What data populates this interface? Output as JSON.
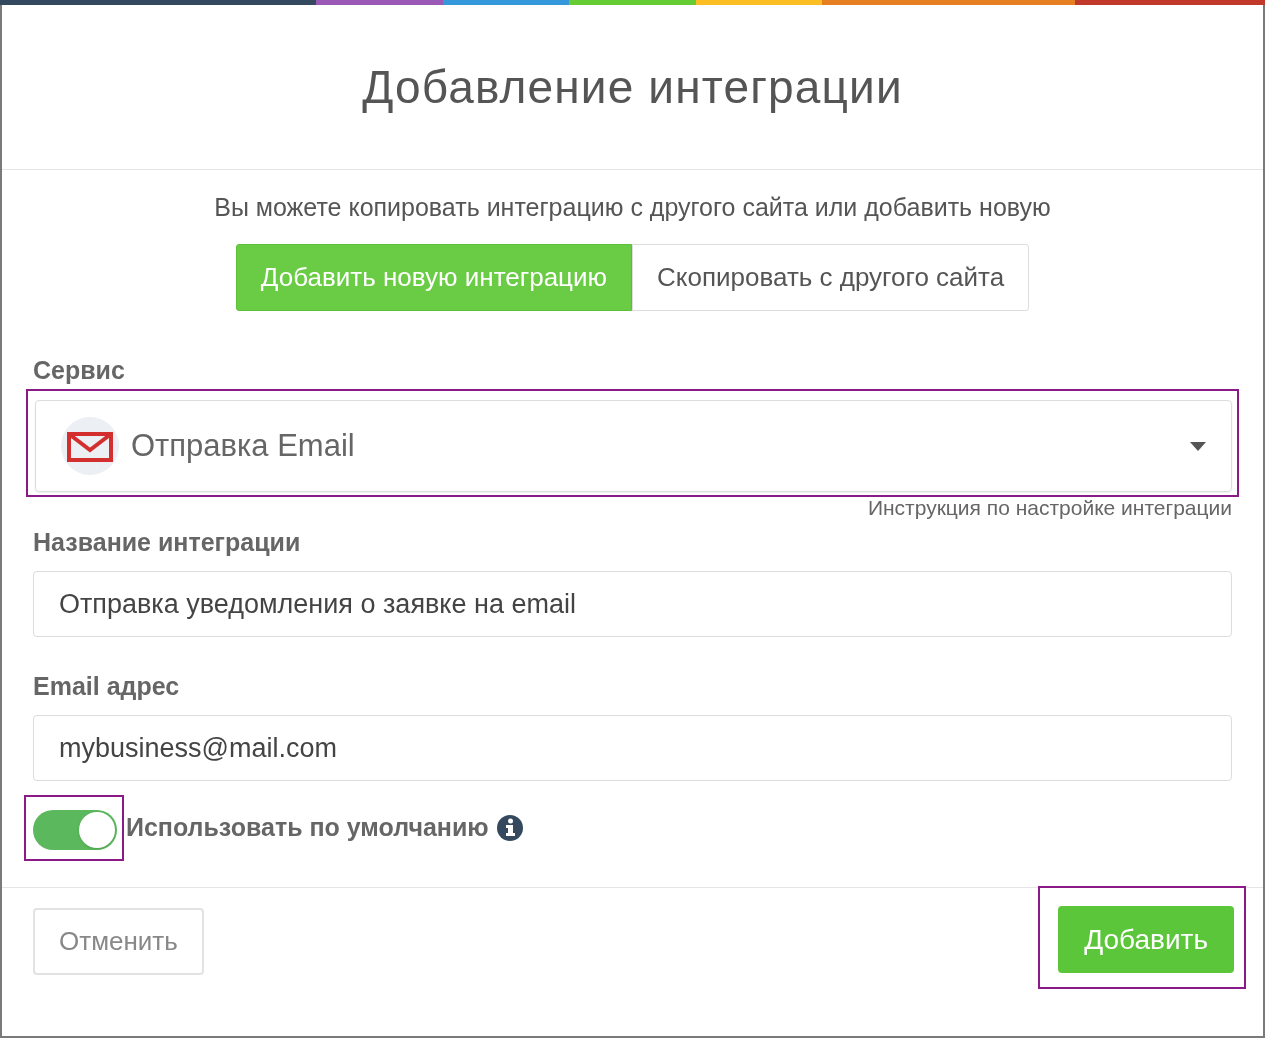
{
  "accent_strip": [
    {
      "color": "#34495e"
    },
    {
      "color": "#9b59b6"
    },
    {
      "color": "#3498db"
    },
    {
      "color": "#66cc33"
    },
    {
      "color": "#fbbf24"
    },
    {
      "color": "#e67e22"
    },
    {
      "color": "#c0392b"
    }
  ],
  "dialog": {
    "title": "Добавление интеграции",
    "intro": "Вы можете копировать интеграцию с другого сайта или добавить новую",
    "modes": [
      {
        "label": "Добавить новую интеграцию",
        "selected": true
      },
      {
        "label": "Скопировать с другого сайта",
        "selected": false
      }
    ],
    "service": {
      "label": "Сервис",
      "value": "Отправка Email",
      "highlighted": true,
      "help_link": "Инструкция по настройке интеграции"
    },
    "fields": [
      {
        "label": "Название интеграции",
        "value": "Отправка уведомления о заявке на email"
      },
      {
        "label": "Email адрес",
        "value": "mybusiness@mail.com"
      }
    ],
    "default_toggle": {
      "label": "Использовать по умолчанию",
      "on": true,
      "highlighted": true
    },
    "buttons": [
      {
        "kind": "cancel",
        "label": "Отменить",
        "highlighted": false
      },
      {
        "kind": "submit",
        "label": "Добавить",
        "highlighted": true
      }
    ]
  }
}
